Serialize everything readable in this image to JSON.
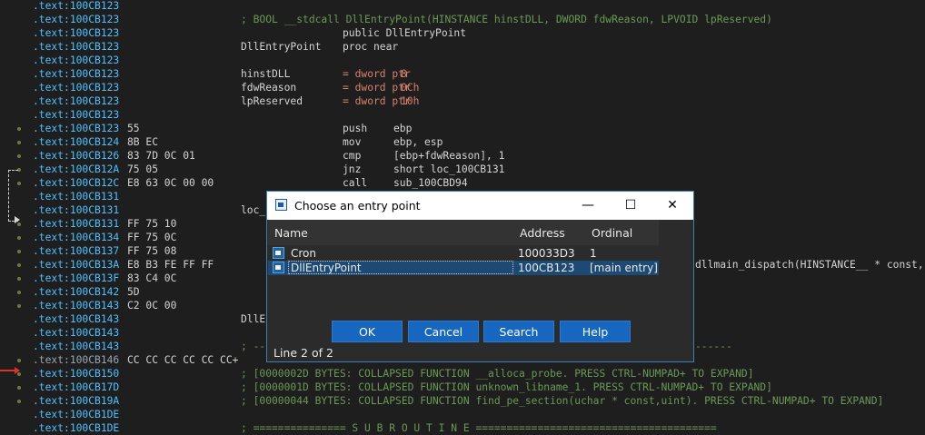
{
  "code": {
    "lines": [
      {
        "seg": ".text:",
        "addr": "100CB123",
        "bytes": "",
        "label": "",
        "mnem": "",
        "ops": "",
        "comment": ""
      },
      {
        "seg": ".text:",
        "addr": "100CB123",
        "bytes": "",
        "label": "",
        "mnem": "",
        "ops": "",
        "comment": "; BOOL __stdcall DllEntryPoint(HINSTANCE hinstDLL, DWORD fdwReason, LPVOID lpReserved)"
      },
      {
        "seg": ".text:",
        "addr": "100CB123",
        "bytes": "",
        "label": "",
        "mnem": "public DllEntryPoint",
        "ops": "",
        "comment": ""
      },
      {
        "seg": ".text:",
        "addr": "100CB123",
        "bytes": "",
        "label": "DllEntryPoint",
        "mnem": "proc near",
        "ops": "",
        "comment": ""
      },
      {
        "seg": ".text:",
        "addr": "100CB123",
        "bytes": "",
        "label": "",
        "mnem": "",
        "ops": "",
        "comment": ""
      },
      {
        "seg": ".text:",
        "addr": "100CB123",
        "bytes": "",
        "label": "hinstDLL",
        "mnem": "= dword ptr",
        "ops": "8",
        "comment": ""
      },
      {
        "seg": ".text:",
        "addr": "100CB123",
        "bytes": "",
        "label": "fdwReason",
        "mnem": "= dword ptr",
        "ops": "0Ch",
        "comment": ""
      },
      {
        "seg": ".text:",
        "addr": "100CB123",
        "bytes": "",
        "label": "lpReserved",
        "mnem": "= dword ptr",
        "ops": "10h",
        "comment": ""
      },
      {
        "seg": ".text:",
        "addr": "100CB123",
        "bytes": "",
        "label": "",
        "mnem": "",
        "ops": "",
        "comment": ""
      },
      {
        "seg": ".text:",
        "addr": "100CB123",
        "bytes": "55",
        "label": "",
        "mnem": "push",
        "ops": "ebp",
        "comment": ""
      },
      {
        "seg": ".text:",
        "addr": "100CB124",
        "bytes": "8B EC",
        "label": "",
        "mnem": "mov",
        "ops": "ebp, esp",
        "comment": ""
      },
      {
        "seg": ".text:",
        "addr": "100CB126",
        "bytes": "83 7D 0C 01",
        "label": "",
        "mnem": "cmp",
        "ops": "[ebp+fdwReason], 1",
        "comment": ""
      },
      {
        "seg": ".text:",
        "addr": "100CB12A",
        "bytes": "75 05",
        "label": "",
        "mnem": "jnz",
        "ops": "short loc_100CB131",
        "comment": ""
      },
      {
        "seg": ".text:",
        "addr": "100CB12C",
        "bytes": "E8 63 0C 00 00",
        "label": "",
        "mnem": "call",
        "ops": "sub_100CBD94",
        "comment": ""
      },
      {
        "seg": ".text:",
        "addr": "100CB131",
        "bytes": "",
        "label": "",
        "mnem": "",
        "ops": "",
        "comment": ""
      },
      {
        "seg": ".text:",
        "addr": "100CB131",
        "bytes": "",
        "label": "loc_",
        "mnem": "",
        "ops": "",
        "comment": ""
      },
      {
        "seg": ".text:",
        "addr": "100CB131",
        "bytes": "FF 75 10",
        "label": "",
        "mnem": "",
        "ops": "",
        "comment": ""
      },
      {
        "seg": ".text:",
        "addr": "100CB134",
        "bytes": "FF 75 0C",
        "label": "",
        "mnem": "",
        "ops": "",
        "comment": ""
      },
      {
        "seg": ".text:",
        "addr": "100CB137",
        "bytes": "FF 75 08",
        "label": "",
        "mnem": "",
        "ops": "",
        "comment": ""
      },
      {
        "seg": ".text:",
        "addr": "100CB13A",
        "bytes": "E8 B3 FE FF FF",
        "label": "",
        "mnem": "",
        "ops": "",
        "comment": ""
      },
      {
        "seg": ".text:",
        "addr": "100CB13F",
        "bytes": "83 C4 0C",
        "label": "",
        "mnem": "",
        "ops": "",
        "comment": ""
      },
      {
        "seg": ".text:",
        "addr": "100CB142",
        "bytes": "5D",
        "label": "",
        "mnem": "",
        "ops": "",
        "comment": ""
      },
      {
        "seg": ".text:",
        "addr": "100CB143",
        "bytes": "C2 0C 00",
        "label": "",
        "mnem": "",
        "ops": "",
        "comment": ""
      },
      {
        "seg": ".text:",
        "addr": "100CB143",
        "bytes": "",
        "label": "DllE",
        "mnem": "",
        "ops": "",
        "comment": ""
      },
      {
        "seg": ".text:",
        "addr": "100CB143",
        "bytes": "",
        "label": "",
        "mnem": "",
        "ops": "",
        "comment": ""
      },
      {
        "seg": ".text:",
        "addr": "100CB143",
        "bytes": "",
        "label": "",
        "mnem": "",
        "ops": "",
        "comment": "; --"
      },
      {
        "seg": ".text:",
        "addr": "100CB146",
        "bytes": "CC CC CC CC CC CC+",
        "label": "",
        "mnem": "",
        "ops": "",
        "comment": ""
      },
      {
        "seg": ".text:",
        "addr": "100CB150",
        "bytes": "",
        "label": "",
        "mnem": "",
        "ops": "",
        "comment": "; [0000002D BYTES: COLLAPSED FUNCTION __alloca_probe. PRESS CTRL-NUMPAD+ TO EXPAND]"
      },
      {
        "seg": ".text:",
        "addr": "100CB17D",
        "bytes": "",
        "label": "",
        "mnem": "",
        "ops": "",
        "comment": "; [0000001D BYTES: COLLAPSED FUNCTION unknown_libname_1. PRESS CTRL-NUMPAD+ TO EXPAND]"
      },
      {
        "seg": ".text:",
        "addr": "100CB19A",
        "bytes": "",
        "label": "",
        "mnem": "",
        "ops": "",
        "comment": "; [00000044 BYTES: COLLAPSED FUNCTION find_pe_section(uchar * const,uint). PRESS CTRL-NUMPAD+ TO EXPAND]"
      },
      {
        "seg": ".text:",
        "addr": "100CB1DE",
        "bytes": "",
        "label": "",
        "mnem": "",
        "ops": "",
        "comment": ""
      },
      {
        "seg": ".text:",
        "addr": "100CB1DE",
        "bytes": "",
        "label": "",
        "mnem": "",
        "ops": "",
        "comment": "; =============== S U B R O U T I N E ======================================="
      }
    ],
    "right_peek_top": "------",
    "right_peek_call": "dllmain_dispatch(HINSTANCE__ * const,"
  },
  "dialog": {
    "title": "Choose an entry point",
    "minimize_glyph": "—",
    "maximize_glyph": "☐",
    "close_glyph": "✕",
    "columns": {
      "name": "Name",
      "address": "Address",
      "ordinal": "Ordinal"
    },
    "rows": [
      {
        "name": "Cron",
        "address": "100033D3",
        "ordinal": "1"
      },
      {
        "name": "DllEntryPoint",
        "address": "100CB123",
        "ordinal": "[main entry]"
      }
    ],
    "buttons": {
      "ok": "OK",
      "cancel": "Cancel",
      "search": "Search",
      "help": "Help"
    },
    "status": "Line 2 of 2"
  }
}
